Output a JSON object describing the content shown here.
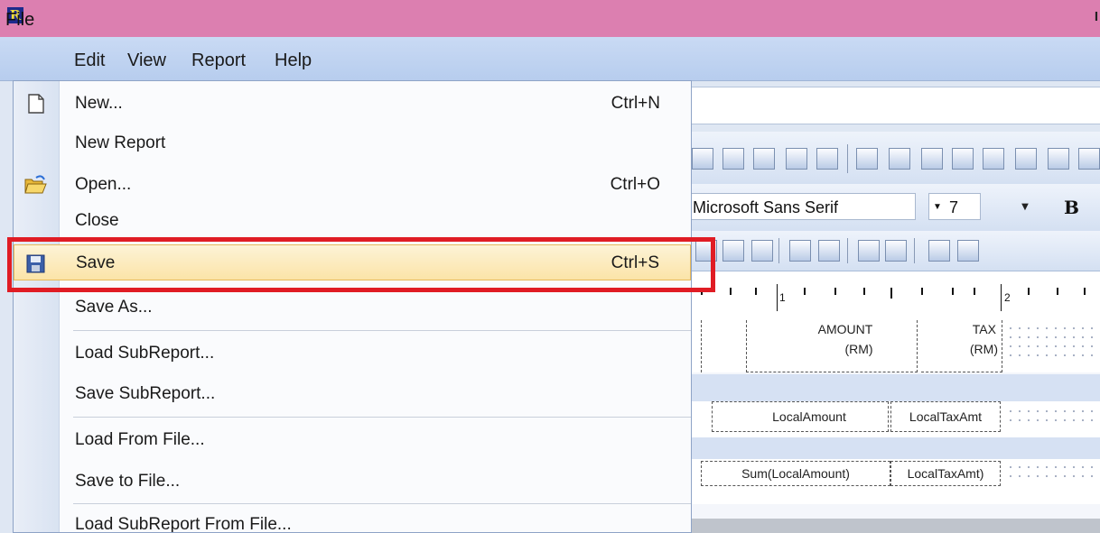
{
  "app": {
    "logo_letter": "R",
    "title_right": "I"
  },
  "menubar": {
    "items": [
      "File",
      "Edit",
      "View",
      "Report",
      "Help"
    ]
  },
  "file_menu": {
    "items": [
      {
        "label": "New...",
        "shortcut": "Ctrl+N",
        "icon": "new-document-icon"
      },
      {
        "label": "New Report",
        "shortcut": ""
      },
      {
        "label": "Open...",
        "shortcut": "Ctrl+O",
        "icon": "open-folder-icon"
      },
      {
        "label": "Close",
        "shortcut": ""
      },
      {
        "label": "Save",
        "shortcut": "Ctrl+S",
        "icon": "floppy-disk-icon",
        "highlighted": true
      },
      {
        "label": "Save As...",
        "shortcut": ""
      },
      {
        "label": "Load SubReport...",
        "shortcut": ""
      },
      {
        "label": "Save SubReport...",
        "shortcut": ""
      },
      {
        "label": "Load From File...",
        "shortcut": ""
      },
      {
        "label": "Save to File...",
        "shortcut": ""
      },
      {
        "label": "Load SubReport From File...",
        "shortcut": ""
      }
    ]
  },
  "toolbar": {
    "font_name": "Microsoft Sans Serif",
    "font_size": "7",
    "bold_label": "B"
  },
  "ruler": {
    "marks": [
      "1",
      "2"
    ]
  },
  "report": {
    "header_amount": "AMOUNT",
    "header_amount_unit": "(RM)",
    "header_tax": "TAX",
    "header_tax_unit": "(RM)",
    "detail_amount": "LocalAmount",
    "detail_tax": "LocalTaxAmt",
    "footer_amount": "Sum(LocalAmount)",
    "footer_tax": "LocalTaxAmt)"
  },
  "colors": {
    "titlebar": "#dc7fb0",
    "highlight_border": "#e01c24",
    "menu_highlight": "#fbe4a8"
  }
}
